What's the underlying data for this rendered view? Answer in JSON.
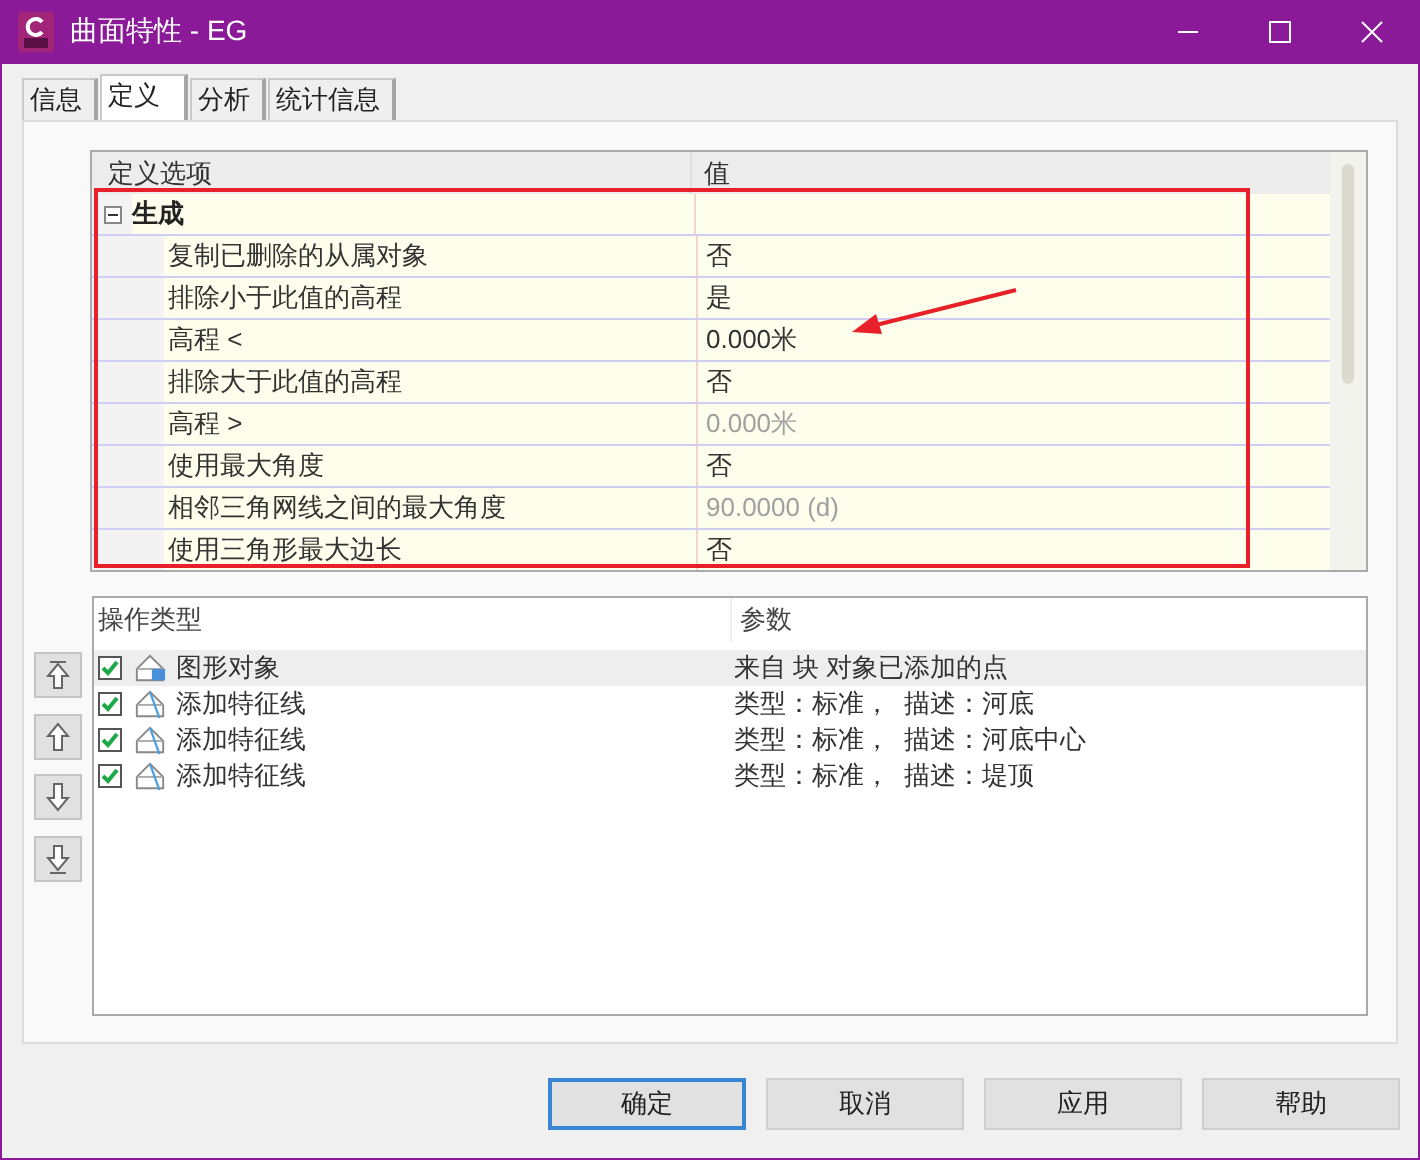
{
  "window": {
    "title": "曲面特性 - EG"
  },
  "tabs": [
    {
      "label": "信息",
      "selected": false
    },
    {
      "label": "定义",
      "selected": true
    },
    {
      "label": "分析",
      "selected": false
    },
    {
      "label": "统计信息",
      "selected": false
    }
  ],
  "definition_grid": {
    "columns": [
      "定义选项",
      "值"
    ],
    "groups": [
      {
        "label": "生成",
        "expanded": true,
        "rows": [
          {
            "option": "复制已删除的从属对象",
            "value": "否",
            "disabled": false
          },
          {
            "option": "排除小于此值的高程",
            "value": "是",
            "disabled": false
          },
          {
            "option": "高程 <",
            "value": "0.000米",
            "disabled": false
          },
          {
            "option": "排除大于此值的高程",
            "value": "否",
            "disabled": false
          },
          {
            "option": "高程 >",
            "value": "0.000米",
            "disabled": true
          },
          {
            "option": "使用最大角度",
            "value": "否",
            "disabled": false
          },
          {
            "option": "相邻三角网线之间的最大角度",
            "value": "90.0000 (d)",
            "disabled": true
          },
          {
            "option": "使用三角形最大边长",
            "value": "否",
            "disabled": false
          }
        ]
      }
    ]
  },
  "operations": {
    "columns": [
      "操作类型",
      "参数"
    ],
    "rows": [
      {
        "kind": "object",
        "type": "图形对象",
        "params": "来自 块 对象已添加的点",
        "checked": true,
        "selected": true
      },
      {
        "kind": "breakline",
        "type": "添加特征线",
        "params": "类型：标准，  描述：河底",
        "checked": true,
        "selected": false
      },
      {
        "kind": "breakline",
        "type": "添加特征线",
        "params": "类型：标准，  描述：河底中心",
        "checked": true,
        "selected": false
      },
      {
        "kind": "breakline",
        "type": "添加特征线",
        "params": "类型：标准，  描述：堤顶",
        "checked": true,
        "selected": false
      }
    ]
  },
  "buttons": [
    {
      "label": "确定",
      "default": true
    },
    {
      "label": "取消",
      "default": false
    },
    {
      "label": "应用",
      "default": false
    },
    {
      "label": "帮助",
      "default": false
    }
  ]
}
